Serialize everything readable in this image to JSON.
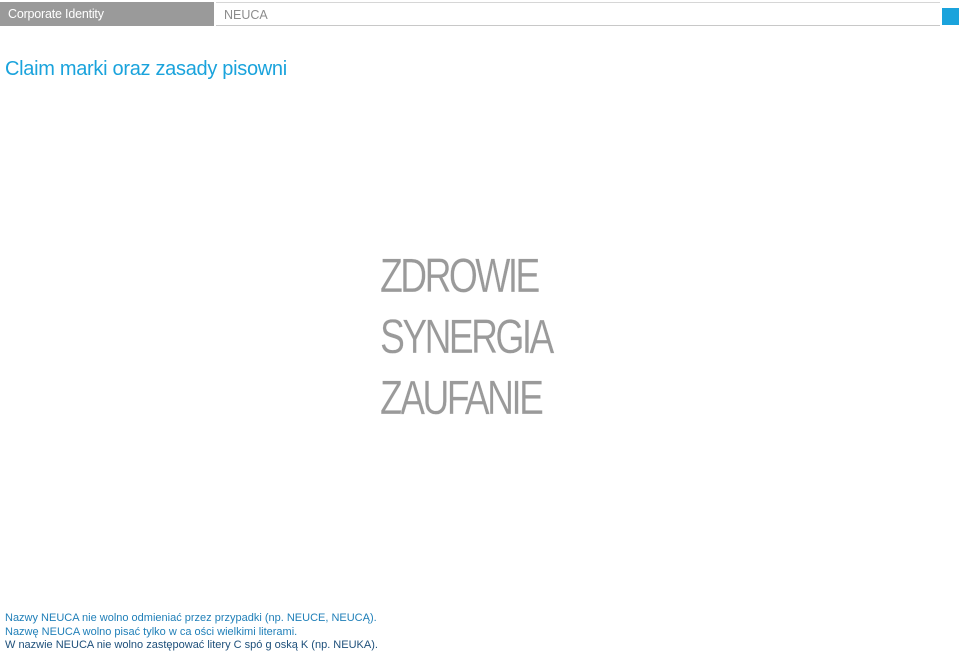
{
  "header": {
    "section": "Corporate Identity",
    "brand": "NEUCA"
  },
  "accent_color": "#1aa3dc",
  "page_title": "Claim marki oraz zasady pisowni",
  "claim": [
    "ZDROWIE",
    "SYNERGIA",
    "ZAUFANIE"
  ],
  "rules": [
    "Nazwy NEUCA nie wolno odmieniać przez przypadki (np. NEUCE, NEUCĄ).",
    "Nazwę NEUCA wolno pisać tylko w ca ości wielkimi literami.",
    "W nazwie NEUCA nie wolno zastępować litery C spó g oską K (np. NEUKA)."
  ]
}
